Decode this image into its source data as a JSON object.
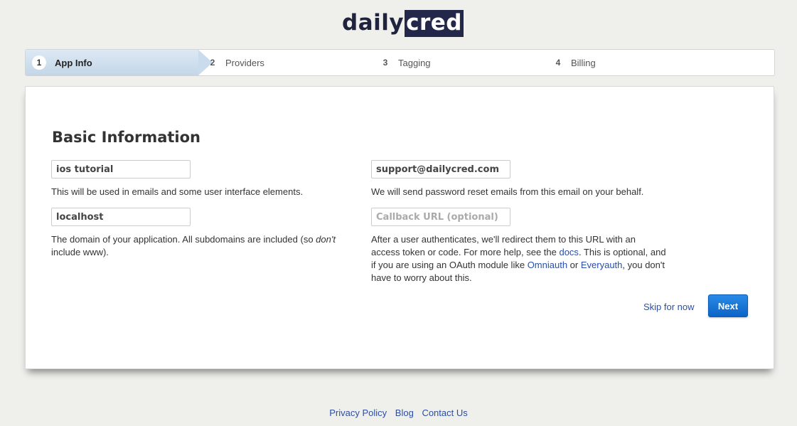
{
  "brand": {
    "part1": "daily",
    "part2": "cred"
  },
  "steps": [
    {
      "num": "1",
      "label": "App Info"
    },
    {
      "num": "2",
      "label": "Providers"
    },
    {
      "num": "3",
      "label": "Tagging"
    },
    {
      "num": "4",
      "label": "Billing"
    }
  ],
  "form": {
    "heading": "Basic Information",
    "app_name": {
      "value": "ios tutorial",
      "help": "This will be used in emails and some user interface elements."
    },
    "email": {
      "value": "support@dailycred.com",
      "help": "We will send password reset emails from this email on your behalf."
    },
    "domain": {
      "value": "localhost",
      "help_part1": "The domain of your application. All subdomains are included (so ",
      "help_em": "don't",
      "help_part2": "include www)."
    },
    "callback": {
      "placeholder": "Callback URL (optional)",
      "help_part1": "After a user authenticates, we'll redirect them to this URL with an access token or code. For more help, see the ",
      "docs_link": "docs",
      "help_part2": ". This is optional, and if you are using an OAuth module like ",
      "omniauth_link": "Omniauth",
      "help_or": " or ",
      "everyauth_link": "Everyauth",
      "help_part3": ", you don't have to worry about this."
    },
    "skip_label": "Skip for now",
    "next_label": "Next"
  },
  "footer": {
    "privacy": "Privacy Policy",
    "blog": "Blog",
    "contact": "Contact Us"
  },
  "colors": {
    "brand_navy": "#23284a",
    "link": "#2a4fa5",
    "button": "#0b63c6",
    "step_active": "#c3d6e8"
  }
}
